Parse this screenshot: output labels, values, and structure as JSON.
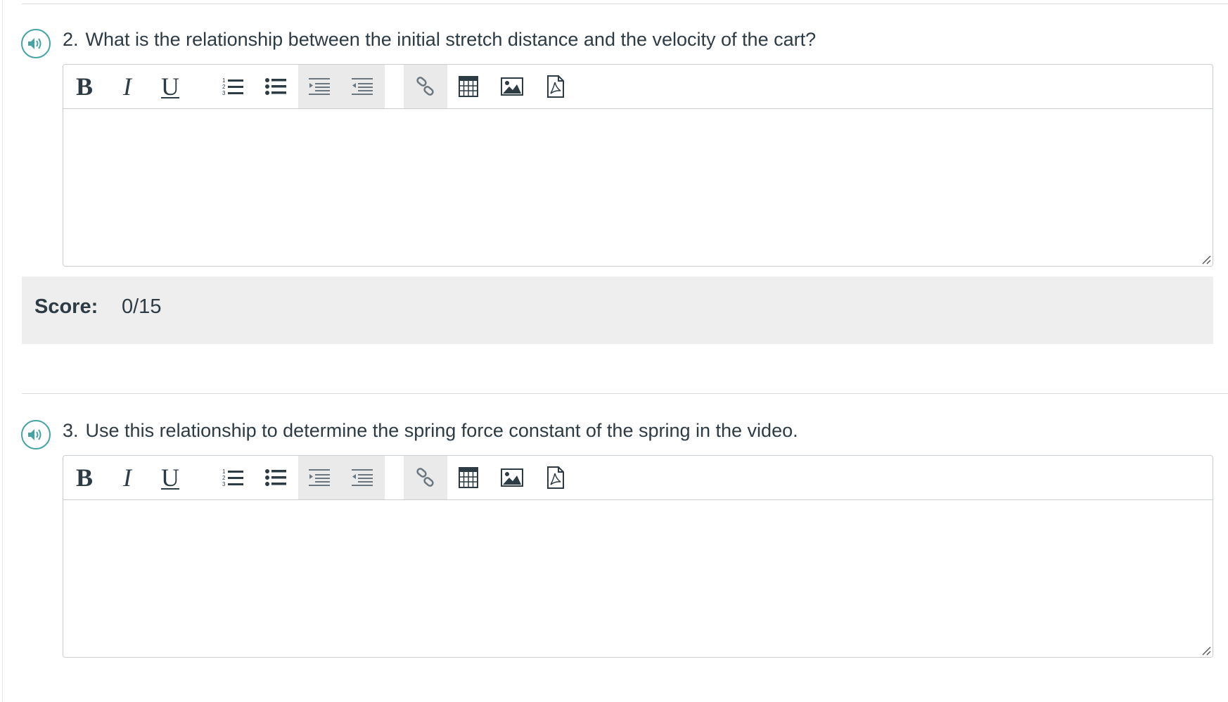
{
  "questions": [
    {
      "number": "2.",
      "text": "What is the relationship between the initial stretch distance and the velocity of the cart?",
      "answer": ""
    },
    {
      "number": "3.",
      "text": "Use this relationship to determine the spring force constant of the spring in the video.",
      "answer": ""
    }
  ],
  "toolbar": {
    "bold": "B",
    "italic": "I",
    "underline": "U",
    "icons": [
      "numbered-list-icon",
      "bulleted-list-icon",
      "indent-icon",
      "outdent-icon",
      "link-icon",
      "table-icon",
      "image-icon",
      "pdf-icon"
    ]
  },
  "score": {
    "label": "Score:",
    "value": "0/15"
  },
  "colors": {
    "speaker_accent": "#46a3a3",
    "score_background": "#eeeeee",
    "toolbar_shaded": "#eaeaea",
    "text": "#2d3b45"
  }
}
